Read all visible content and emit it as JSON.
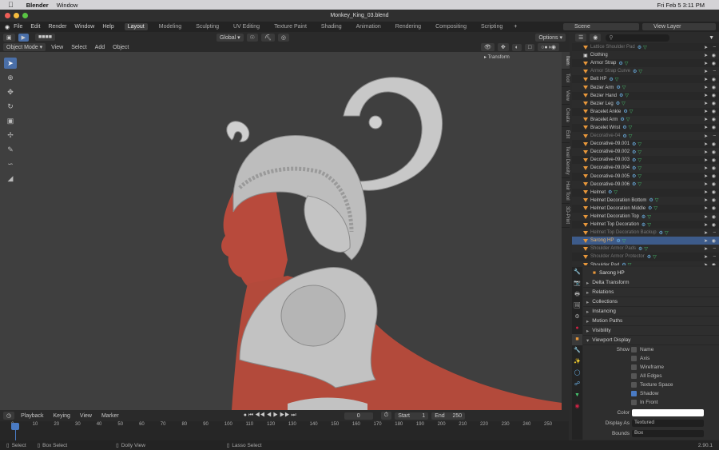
{
  "macbar": {
    "app": "Blender",
    "menu": [
      "Window"
    ],
    "clock": "Fri Feb 5  3:11 PM"
  },
  "window_title": "Monkey_King_03.blend",
  "topbar": {
    "menus": [
      "File",
      "Edit",
      "Render",
      "Window",
      "Help"
    ],
    "workspaces": [
      "Layout",
      "Modeling",
      "Sculpting",
      "UV Editing",
      "Texture Paint",
      "Shading",
      "Animation",
      "Rendering",
      "Compositing",
      "Scripting"
    ],
    "active_workspace": "Layout",
    "scene": "Scene",
    "view_layer": "View Layer"
  },
  "viewport_header": {
    "transform": "Global",
    "options": "Options",
    "mode": "Object Mode",
    "menus": [
      "View",
      "Select",
      "Add",
      "Object"
    ],
    "n_panel_title": "Transform"
  },
  "n_tabs": [
    "Item",
    "Tool",
    "View",
    "Create",
    "Edit",
    "Texel Density",
    "Hair Tool",
    "3D-Print"
  ],
  "outliner": {
    "rows": [
      {
        "name": "Lattice Shoulder Pad",
        "dim": true
      },
      {
        "name": "Clothing",
        "collection": true
      },
      {
        "name": "Armor Strap"
      },
      {
        "name": "Armor Strap Curve",
        "dim": true
      },
      {
        "name": "Belt HP"
      },
      {
        "name": "Bezier Arm"
      },
      {
        "name": "Bezier Hand"
      },
      {
        "name": "Bezier Leg"
      },
      {
        "name": "Bracelet Ankle"
      },
      {
        "name": "Bracelet Arm"
      },
      {
        "name": "Bracelet Wrist"
      },
      {
        "name": "Decorative-04",
        "dim": true
      },
      {
        "name": "Decorative-09.001"
      },
      {
        "name": "Decorative-09.002"
      },
      {
        "name": "Decorative-09.003"
      },
      {
        "name": "Decorative-09.004"
      },
      {
        "name": "Decorative-09.005"
      },
      {
        "name": "Decorative-09.006"
      },
      {
        "name": "Helmet"
      },
      {
        "name": "Helmet Decoration Bottom"
      },
      {
        "name": "Helmet Decoration Middle"
      },
      {
        "name": "Helmet Decoration Top"
      },
      {
        "name": "Helmet Top Decoration"
      },
      {
        "name": "Helmet Top Decoration Backup",
        "dim": true
      },
      {
        "name": "Sarong HP",
        "selected": true
      },
      {
        "name": "Shoulder Armor Pads",
        "dim": true
      },
      {
        "name": "Shoulder Armor Protector",
        "dim": true
      },
      {
        "name": "Shoulder Pad"
      }
    ]
  },
  "properties": {
    "object_name": "Sarong HP",
    "sections": [
      "Delta Transform",
      "Relations",
      "Collections",
      "Instancing",
      "Motion Paths",
      "Visibility",
      "Viewport Display"
    ],
    "show_label": "Show",
    "options": [
      {
        "label": "Name",
        "checked": false
      },
      {
        "label": "Axis",
        "checked": false
      },
      {
        "label": "Wireframe",
        "checked": false
      },
      {
        "label": "All Edges",
        "checked": false
      },
      {
        "label": "Texture Space",
        "checked": false
      },
      {
        "label": "Shadow",
        "checked": true
      },
      {
        "label": "In Front",
        "checked": false
      }
    ],
    "color_label": "Color",
    "display_as_label": "Display As",
    "display_as_value": "Textured",
    "bounds_label": "Bounds",
    "bounds_value": "Box"
  },
  "timeline": {
    "menus": [
      "Playback",
      "Keying",
      "View",
      "Marker"
    ],
    "current_frame": "0",
    "start_label": "Start",
    "start": "1",
    "end_label": "End",
    "end": "250",
    "ticks": [
      "0",
      "10",
      "20",
      "30",
      "40",
      "50",
      "60",
      "70",
      "80",
      "90",
      "100",
      "110",
      "120",
      "130",
      "140",
      "150",
      "160",
      "170",
      "180",
      "190",
      "200",
      "210",
      "220",
      "230",
      "240",
      "250"
    ]
  },
  "statusbar": {
    "items": [
      "Select",
      "Box Select",
      "Dolly View",
      "Lasso Select"
    ],
    "version": "2.90.1"
  }
}
